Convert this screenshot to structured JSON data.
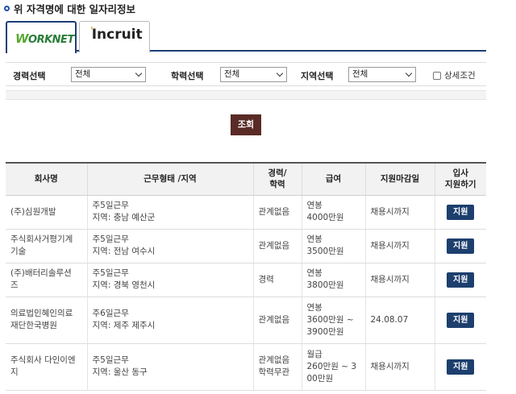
{
  "section_title": "위 자격명에 대한 일자리정보",
  "tabs": [
    {
      "name": "WORKNET",
      "logo_first": "W",
      "logo_rest": "ORKNET",
      "active": true
    },
    {
      "name": "Incruit",
      "logo_dot": "'",
      "logo_text": "Incruit",
      "active": false
    }
  ],
  "filters": {
    "career_label": "경력선택",
    "career_value": "전체",
    "education_label": "학력선택",
    "education_value": "전체",
    "region_label": "지역선택",
    "region_value": "전체",
    "detail_label": "상세조건"
  },
  "search_button": "조회",
  "table": {
    "headers": [
      "회사명",
      "근무형태 /지역",
      "경력/\n학력",
      "급여",
      "지원마감일",
      "입사\n지원하기"
    ],
    "rows": [
      {
        "company": "(주)심원개발",
        "work_type": "주5일근무",
        "region": "지역: 충남 예산군",
        "career": "관계없음",
        "salary": "연봉\n4000만원",
        "deadline": "채용시까지",
        "apply": "지원"
      },
      {
        "company": "주식회사거평기계\n기술",
        "work_type": "주5일근무",
        "region": "지역: 전남 여수시",
        "career": "관계없음",
        "salary": "연봉\n3500만원",
        "deadline": "채용시까지",
        "apply": "지원"
      },
      {
        "company": "(주)배터리솔루션\n즈",
        "work_type": "주5일근무",
        "region": "지역: 경북 영천시",
        "career": "경력",
        "salary": "연봉\n3800만원",
        "deadline": "채용시까지",
        "apply": "지원"
      },
      {
        "company": "의료법인혜인의료\n재단한국병원",
        "work_type": "주6일근무",
        "region": "지역: 제주 제주시",
        "career": "관계없음",
        "salary": "연봉\n3600만원 ~\n3900만원",
        "deadline": "24.08.07",
        "apply": "지원"
      },
      {
        "company": "주식회사 다인이엔\n지",
        "work_type": "주5일근무",
        "region": "지역: 울산 동구",
        "career": "관계없음\n학력무관",
        "salary": "월급\n260만원 ~ 3\n00만원",
        "deadline": "채용시까지",
        "apply": "지원"
      }
    ]
  },
  "colors": {
    "tab_border": "#1f3e78",
    "search_button": "#5a2b26",
    "apply_button": "#1d3f6e"
  }
}
